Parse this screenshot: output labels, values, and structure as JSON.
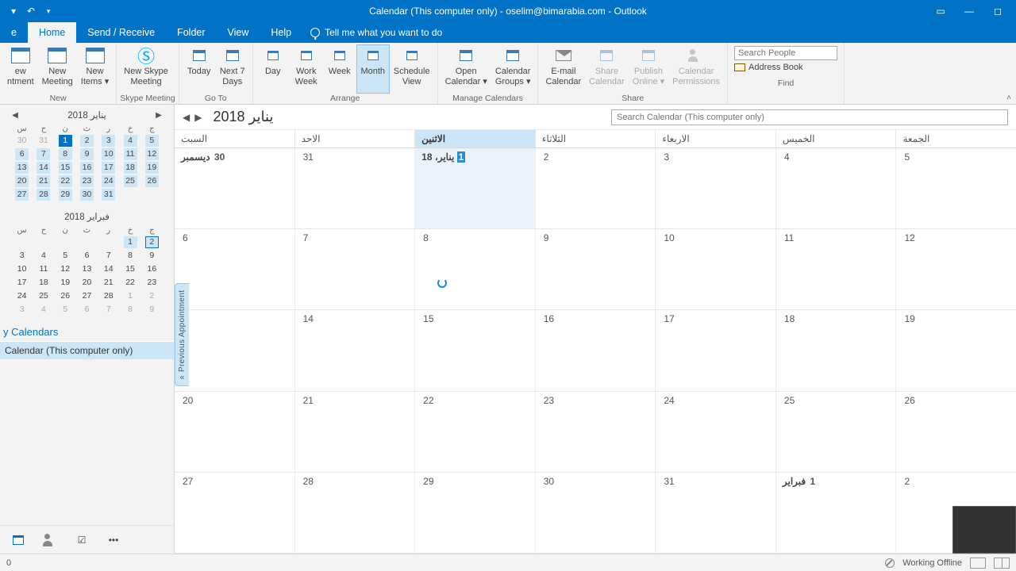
{
  "title": "Calendar (This computer only) -  oselim@bimarabia.com  -  Outlook",
  "tabs": {
    "file": "e",
    "home": "Home",
    "sendreceive": "Send / Receive",
    "folder": "Folder",
    "view": "View",
    "help": "Help"
  },
  "tell_me": "Tell me what you want to do",
  "ribbon": {
    "new": {
      "appointment": "ew\nntment",
      "meeting": "New\nMeeting",
      "items": "New\nItems ▾",
      "group": "New"
    },
    "skype": {
      "btn": "New Skype\nMeeting",
      "group": "Skype Meeting"
    },
    "goto": {
      "today": "Today",
      "next7": "Next 7\nDays",
      "group": "Go To"
    },
    "arrange": {
      "day": "Day",
      "workweek": "Work\nWeek",
      "week": "Week",
      "month": "Month",
      "schedule": "Schedule\nView",
      "group": "Arrange"
    },
    "manage": {
      "open": "Open\nCalendar ▾",
      "groups": "Calendar\nGroups ▾",
      "group": "Manage Calendars"
    },
    "share": {
      "email": "E-mail\nCalendar",
      "share": "Share\nCalendar",
      "publish": "Publish\nOnline ▾",
      "perms": "Calendar\nPermissions",
      "group": "Share"
    },
    "find": {
      "placeholder": "Search People",
      "address": "Address Book",
      "group": "Find"
    }
  },
  "minical1": {
    "title": "يناير 2018",
    "dow": [
      "س",
      "ح",
      "ن",
      "ث",
      "ر",
      "خ",
      "ج"
    ],
    "rows": [
      [
        {
          "n": "30",
          "c": "dim"
        },
        {
          "n": "31",
          "c": "dim"
        },
        {
          "n": "1",
          "c": "sel"
        },
        {
          "n": "2",
          "c": "hl"
        },
        {
          "n": "3",
          "c": "hl"
        },
        {
          "n": "4",
          "c": "hl"
        },
        {
          "n": "5",
          "c": "hl"
        }
      ],
      [
        {
          "n": "6",
          "c": "hl"
        },
        {
          "n": "7",
          "c": "hl"
        },
        {
          "n": "8",
          "c": "hl"
        },
        {
          "n": "9",
          "c": "hl"
        },
        {
          "n": "10",
          "c": "hl"
        },
        {
          "n": "11",
          "c": "hl"
        },
        {
          "n": "12",
          "c": "hl"
        }
      ],
      [
        {
          "n": "13",
          "c": "hl"
        },
        {
          "n": "14",
          "c": "hl"
        },
        {
          "n": "15",
          "c": "hl"
        },
        {
          "n": "16",
          "c": "hl"
        },
        {
          "n": "17",
          "c": "hl"
        },
        {
          "n": "18",
          "c": "hl"
        },
        {
          "n": "19",
          "c": "hl"
        }
      ],
      [
        {
          "n": "20",
          "c": "hl"
        },
        {
          "n": "21",
          "c": "hl"
        },
        {
          "n": "22",
          "c": "hl"
        },
        {
          "n": "23",
          "c": "hl"
        },
        {
          "n": "24",
          "c": "hl"
        },
        {
          "n": "25",
          "c": "hl"
        },
        {
          "n": "26",
          "c": "hl"
        }
      ],
      [
        {
          "n": "27",
          "c": "hl"
        },
        {
          "n": "28",
          "c": "hl"
        },
        {
          "n": "29",
          "c": "hl"
        },
        {
          "n": "30",
          "c": "hl"
        },
        {
          "n": "31",
          "c": "hl"
        },
        {
          "n": "",
          "c": ""
        },
        {
          "n": "",
          "c": ""
        }
      ]
    ]
  },
  "minical2": {
    "title": "فبراير 2018",
    "dow": [
      "س",
      "ح",
      "ن",
      "ث",
      "ر",
      "خ",
      "ج"
    ],
    "rows": [
      [
        {
          "n": "",
          "c": ""
        },
        {
          "n": "",
          "c": ""
        },
        {
          "n": "",
          "c": ""
        },
        {
          "n": "",
          "c": ""
        },
        {
          "n": "",
          "c": ""
        },
        {
          "n": "1",
          "c": "hl"
        },
        {
          "n": "2",
          "c": "hl box"
        }
      ],
      [
        {
          "n": "3",
          "c": ""
        },
        {
          "n": "4",
          "c": ""
        },
        {
          "n": "5",
          "c": ""
        },
        {
          "n": "6",
          "c": ""
        },
        {
          "n": "7",
          "c": ""
        },
        {
          "n": "8",
          "c": ""
        },
        {
          "n": "9",
          "c": ""
        }
      ],
      [
        {
          "n": "10",
          "c": ""
        },
        {
          "n": "11",
          "c": ""
        },
        {
          "n": "12",
          "c": ""
        },
        {
          "n": "13",
          "c": ""
        },
        {
          "n": "14",
          "c": ""
        },
        {
          "n": "15",
          "c": ""
        },
        {
          "n": "16",
          "c": ""
        }
      ],
      [
        {
          "n": "17",
          "c": ""
        },
        {
          "n": "18",
          "c": ""
        },
        {
          "n": "19",
          "c": ""
        },
        {
          "n": "20",
          "c": ""
        },
        {
          "n": "21",
          "c": ""
        },
        {
          "n": "22",
          "c": ""
        },
        {
          "n": "23",
          "c": ""
        }
      ],
      [
        {
          "n": "24",
          "c": ""
        },
        {
          "n": "25",
          "c": ""
        },
        {
          "n": "26",
          "c": ""
        },
        {
          "n": "27",
          "c": ""
        },
        {
          "n": "28",
          "c": ""
        },
        {
          "n": "1",
          "c": "dim"
        },
        {
          "n": "2",
          "c": "dim"
        }
      ],
      [
        {
          "n": "3",
          "c": "dim"
        },
        {
          "n": "4",
          "c": "dim"
        },
        {
          "n": "5",
          "c": "dim"
        },
        {
          "n": "6",
          "c": "dim"
        },
        {
          "n": "7",
          "c": "dim"
        },
        {
          "n": "8",
          "c": "dim"
        },
        {
          "n": "9",
          "c": "dim"
        }
      ]
    ]
  },
  "sidebar": {
    "section": "y Calendars",
    "item": "Calendar (This computer only)"
  },
  "calview": {
    "title": "يناير 2018",
    "search_placeholder": "Search Calendar (This computer only)",
    "dayheaders": [
      "السبت",
      "الاحد",
      "الاثنين",
      "الثلاثاء",
      "الاربعاء",
      "الخميس",
      "الجمعة"
    ],
    "today_index": 2,
    "weeks": [
      [
        {
          "t": "ديسمبر 30",
          "bold": true
        },
        {
          "t": "31"
        },
        {
          "t": "يناير، 18 1",
          "today": true,
          "bold": true
        },
        {
          "t": "2"
        },
        {
          "t": "3"
        },
        {
          "t": "4"
        },
        {
          "t": "5"
        }
      ],
      [
        {
          "t": "6"
        },
        {
          "t": "7"
        },
        {
          "t": "8"
        },
        {
          "t": "9"
        },
        {
          "t": "10"
        },
        {
          "t": "11"
        },
        {
          "t": "12"
        }
      ],
      [
        {
          "t": ""
        },
        {
          "t": "14"
        },
        {
          "t": "15"
        },
        {
          "t": "16"
        },
        {
          "t": "17"
        },
        {
          "t": "18"
        },
        {
          "t": "19"
        }
      ],
      [
        {
          "t": "20"
        },
        {
          "t": "21"
        },
        {
          "t": "22"
        },
        {
          "t": "23"
        },
        {
          "t": "24"
        },
        {
          "t": "25"
        },
        {
          "t": "26"
        }
      ],
      [
        {
          "t": "27"
        },
        {
          "t": "28"
        },
        {
          "t": "29"
        },
        {
          "t": "30"
        },
        {
          "t": "31"
        },
        {
          "t": "فبراير 1",
          "bold": true
        },
        {
          "t": "2"
        }
      ]
    ],
    "prev_appt": "Previous Appointment"
  },
  "status": {
    "left": "0",
    "offline": "Working Offline"
  }
}
